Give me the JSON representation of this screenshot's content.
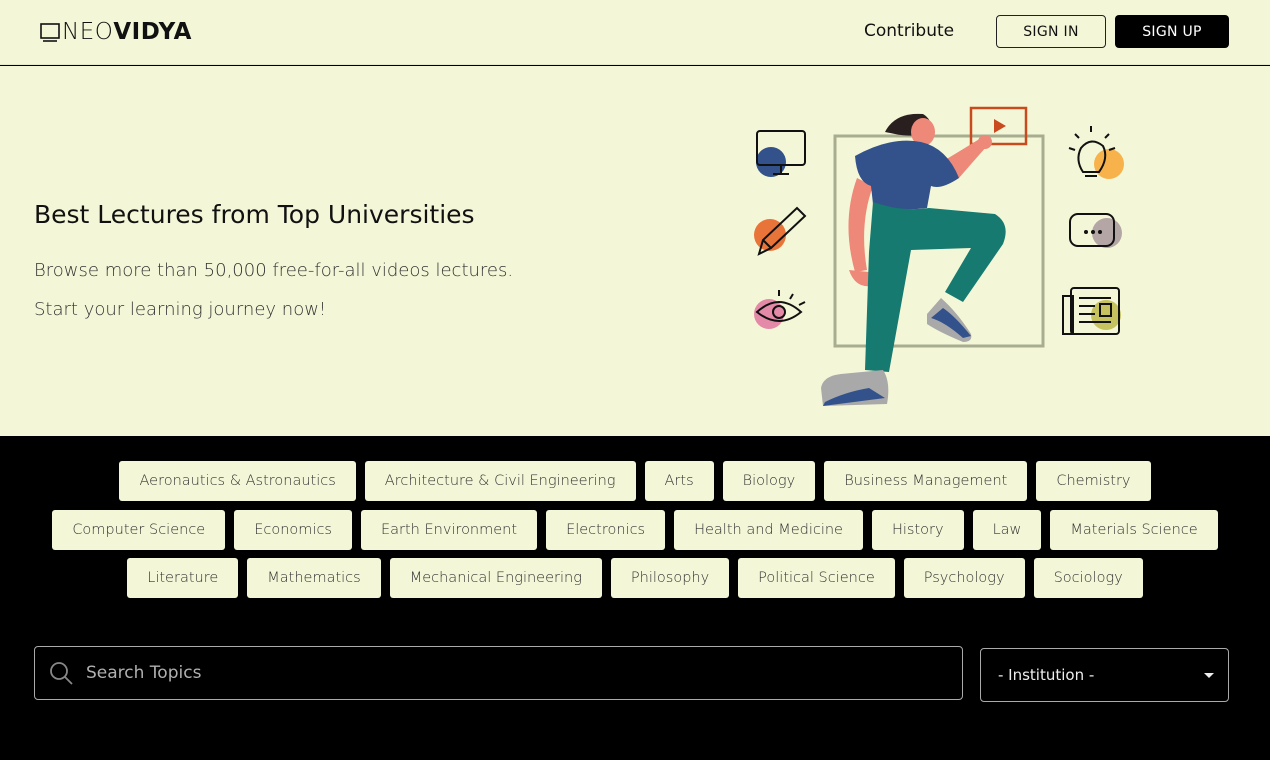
{
  "header": {
    "logo_light": "NEO",
    "logo_bold": "VIDYA",
    "contribute_label": "Contribute",
    "signin_label": "SIGN IN",
    "signup_label": "SIGN UP"
  },
  "hero": {
    "title": "Best Lectures from Top Universities",
    "subtitle_line1": "Browse more than 50,000 free-for-all videos lectures.",
    "subtitle_line2": "Start your learning journey now!"
  },
  "topics": {
    "rows": [
      [
        "Aeronautics & Astronautics",
        "Architecture & Civil Engineering",
        "Arts",
        "Biology",
        "Business Management",
        "Chemistry"
      ],
      [
        "Computer Science",
        "Economics",
        "Earth Environment",
        "Electronics",
        "Health and Medicine",
        "History",
        "Law",
        "Materials Science"
      ],
      [
        "Literature",
        "Mathematics",
        "Mechanical Engineering",
        "Philosophy",
        "Political Science",
        "Psychology",
        "Sociology"
      ]
    ]
  },
  "search": {
    "placeholder": "Search Topics",
    "icon": "search-icon"
  },
  "institution_select": {
    "selected": "- Institution -"
  },
  "colors": {
    "cream": "#f4f7d7",
    "black": "#000000",
    "teal": "#167a70",
    "navy": "#33528b",
    "salmon": "#ee8878",
    "orange_red": "#c94a1e"
  }
}
